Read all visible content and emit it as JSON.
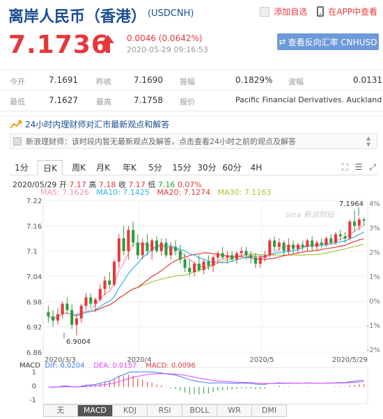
{
  "header": {
    "title": "离岸人民币（香港）",
    "symbol": "(USDCNH)",
    "add_watch": "添加自选",
    "app_view": "在APP中查看"
  },
  "quote": {
    "price": "7.1736",
    "change": "0.0046 (0.0642%)",
    "timestamp": "2020-05-29 09:16:53",
    "reverse_button": "查看反向汇率 CNHUSD"
  },
  "table": {
    "row1": [
      {
        "label": "今开",
        "value": "7.1691"
      },
      {
        "label": "昨收",
        "value": "7.1690"
      },
      {
        "label": "振幅",
        "value": "0.1829%"
      },
      {
        "label": "波幅",
        "value": "0.0131"
      }
    ],
    "row2": [
      {
        "label": "最低",
        "value": "7.1627"
      },
      {
        "label": "最高",
        "value": "7.1758"
      },
      {
        "label": "报价",
        "value": "Pacific Financial Derivatives. Auckland"
      }
    ]
  },
  "expert": {
    "title": "24小时内理财师对汇市最新观点和解答",
    "message": "新浪理财师：该时段内暂无最新观点及解答，点击查看24小时之前的观点及解答"
  },
  "tabs": [
    "1分",
    "日K",
    "周K",
    "月K",
    "年K",
    "5分",
    "15分",
    "30分",
    "60分",
    "4H"
  ],
  "active_tab": "日K",
  "tool_icons": [
    "expand-icon",
    "list-icon",
    "fullscreen-icon"
  ],
  "ohlc": {
    "date": "2020/05/29",
    "open_label": "开",
    "open": "7.17",
    "high_label": "高",
    "high": "7.18",
    "close_label": "收",
    "close": "7.17",
    "low_label": "低",
    "low": "7.16",
    "change": "0.07%"
  },
  "ma": {
    "ma5": "MA5: 7.1626",
    "ma10": "MA10: 7.1425",
    "ma20": "MA20: 7.1274",
    "ma30": "MA30: 7.1163"
  },
  "macd": {
    "name": "MACD",
    "dif": "DIF: 0.0204",
    "dea": "DEA: 0.0157",
    "macd": "MACD: 0.0096"
  },
  "indicator_tabs": [
    "无",
    "MACD",
    "KDJ",
    "RSI",
    "BOLL",
    "WR",
    "DMI"
  ],
  "active_indicator": "MACD",
  "watermark": "sina 新浪财经",
  "colors": {
    "up": "#e4393c",
    "down": "#2a9d3c",
    "ma5": "#ff8fb3",
    "ma10": "#2cb5e8",
    "ma20": "#e4393c",
    "ma30": "#a6c33c",
    "macd_dif": "#3d7ef0",
    "macd_dea": "#e040fb"
  },
  "chart_data": {
    "type": "candlestick",
    "y_ticks": [
      "7.22",
      "7.16",
      "7.1",
      "7.04",
      "6.98",
      "6.92",
      "6.86"
    ],
    "y_right_ticks": [
      "4%",
      "3%",
      "2%",
      "1%",
      "0%",
      "-1%",
      "-2%"
    ],
    "ylim": [
      6.86,
      7.22
    ],
    "x_tick_labels": [
      "2020/3/3",
      "2020/4",
      "2020/5",
      "2020/5/29"
    ],
    "annotations": {
      "high": "7.1964",
      "low": "6.9004"
    },
    "macd_y_ticks": [
      "1",
      "0",
      "-1"
    ],
    "candles": [
      [
        6.955,
        6.97,
        6.93,
        6.945
      ],
      [
        6.945,
        6.96,
        6.92,
        6.935
      ],
      [
        6.935,
        6.965,
        6.925,
        6.95
      ],
      [
        6.95,
        6.98,
        6.94,
        6.975
      ],
      [
        6.975,
        6.99,
        6.95,
        6.96
      ],
      [
        6.96,
        6.975,
        6.915,
        6.925
      ],
      [
        6.925,
        6.95,
        6.9,
        6.94
      ],
      [
        6.94,
        6.975,
        6.93,
        6.97
      ],
      [
        6.97,
        7.0,
        6.96,
        6.99
      ],
      [
        6.99,
        7.0,
        6.965,
        6.975
      ],
      [
        6.975,
        6.99,
        6.955,
        6.985
      ],
      [
        6.985,
        7.02,
        6.98,
        7.01
      ],
      [
        7.01,
        7.04,
        6.995,
        7.03
      ],
      [
        7.03,
        7.05,
        7.01,
        7.02
      ],
      [
        7.02,
        7.08,
        7.015,
        7.075
      ],
      [
        7.075,
        7.14,
        7.06,
        7.13
      ],
      [
        7.13,
        7.16,
        7.09,
        7.1
      ],
      [
        7.1,
        7.16,
        7.08,
        7.15
      ],
      [
        7.15,
        7.17,
        7.11,
        7.12
      ],
      [
        7.12,
        7.14,
        7.08,
        7.09
      ],
      [
        7.09,
        7.13,
        7.08,
        7.12
      ],
      [
        7.12,
        7.14,
        7.09,
        7.1
      ],
      [
        7.1,
        7.13,
        7.08,
        7.125
      ],
      [
        7.125,
        7.135,
        7.095,
        7.1
      ],
      [
        7.1,
        7.13,
        7.09,
        7.12
      ],
      [
        7.12,
        7.13,
        7.085,
        7.09
      ],
      [
        7.09,
        7.12,
        7.08,
        7.11
      ],
      [
        7.11,
        7.125,
        7.09,
        7.1
      ],
      [
        7.1,
        7.115,
        7.07,
        7.08
      ],
      [
        7.08,
        7.095,
        7.05,
        7.06
      ],
      [
        7.06,
        7.08,
        7.04,
        7.05
      ],
      [
        7.05,
        7.075,
        7.04,
        7.07
      ],
      [
        7.07,
        7.09,
        7.05,
        7.055
      ],
      [
        7.055,
        7.08,
        7.045,
        7.075
      ],
      [
        7.075,
        7.09,
        7.055,
        7.065
      ],
      [
        7.065,
        7.09,
        7.05,
        7.085
      ],
      [
        7.085,
        7.1,
        7.07,
        7.095
      ],
      [
        7.095,
        7.11,
        7.08,
        7.085
      ],
      [
        7.085,
        7.1,
        7.07,
        7.09
      ],
      [
        7.09,
        7.1,
        7.075,
        7.08
      ],
      [
        7.08,
        7.1,
        7.07,
        7.095
      ],
      [
        7.095,
        7.11,
        7.085,
        7.1
      ],
      [
        7.1,
        7.11,
        7.08,
        7.09
      ],
      [
        7.09,
        7.1,
        7.07,
        7.085
      ],
      [
        7.085,
        7.095,
        7.06,
        7.07
      ],
      [
        7.07,
        7.09,
        7.06,
        7.085
      ],
      [
        7.085,
        7.1,
        7.075,
        7.09
      ],
      [
        7.09,
        7.13,
        7.085,
        7.125
      ],
      [
        7.125,
        7.135,
        7.1,
        7.11
      ],
      [
        7.11,
        7.13,
        7.1,
        7.12
      ],
      [
        7.12,
        7.125,
        7.09,
        7.1
      ],
      [
        7.1,
        7.13,
        7.09,
        7.115
      ],
      [
        7.115,
        7.125,
        7.095,
        7.105
      ],
      [
        7.105,
        7.12,
        7.095,
        7.115
      ],
      [
        7.115,
        7.125,
        7.1,
        7.11
      ],
      [
        7.11,
        7.13,
        7.1,
        7.125
      ],
      [
        7.125,
        7.135,
        7.1,
        7.11
      ],
      [
        7.11,
        7.125,
        7.1,
        7.12
      ],
      [
        7.12,
        7.13,
        7.105,
        7.115
      ],
      [
        7.115,
        7.135,
        7.11,
        7.13
      ],
      [
        7.13,
        7.14,
        7.115,
        7.12
      ],
      [
        7.12,
        7.145,
        7.115,
        7.14
      ],
      [
        7.14,
        7.15,
        7.125,
        7.135
      ],
      [
        7.135,
        7.145,
        7.12,
        7.13
      ],
      [
        7.13,
        7.175,
        7.125,
        7.17
      ],
      [
        7.17,
        7.1964,
        7.145,
        7.16
      ],
      [
        7.16,
        7.18,
        7.15,
        7.175
      ],
      [
        7.175,
        7.18,
        7.16,
        7.172
      ]
    ]
  }
}
